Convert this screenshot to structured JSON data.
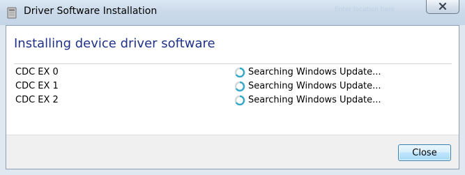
{
  "window": {
    "title": "Driver Software Installation",
    "background_search_hint": "Enter location here"
  },
  "main": {
    "heading": "Installing device driver software",
    "devices": [
      {
        "name": "CDC EX 0",
        "status": "Searching Windows Update...",
        "status_icon": "busy-spinner-icon"
      },
      {
        "name": "CDC EX 1",
        "status": "Searching Windows Update...",
        "status_icon": "busy-spinner-icon"
      },
      {
        "name": "CDC EX 2",
        "status": "Searching Windows Update...",
        "status_icon": "busy-spinner-icon"
      }
    ]
  },
  "footer": {
    "close_label": "Close"
  },
  "colors": {
    "heading": "#1e3287",
    "titlebar": "#c4d5e8",
    "button_border": "#3c7fb1",
    "spinner": "#3aa9c9"
  }
}
